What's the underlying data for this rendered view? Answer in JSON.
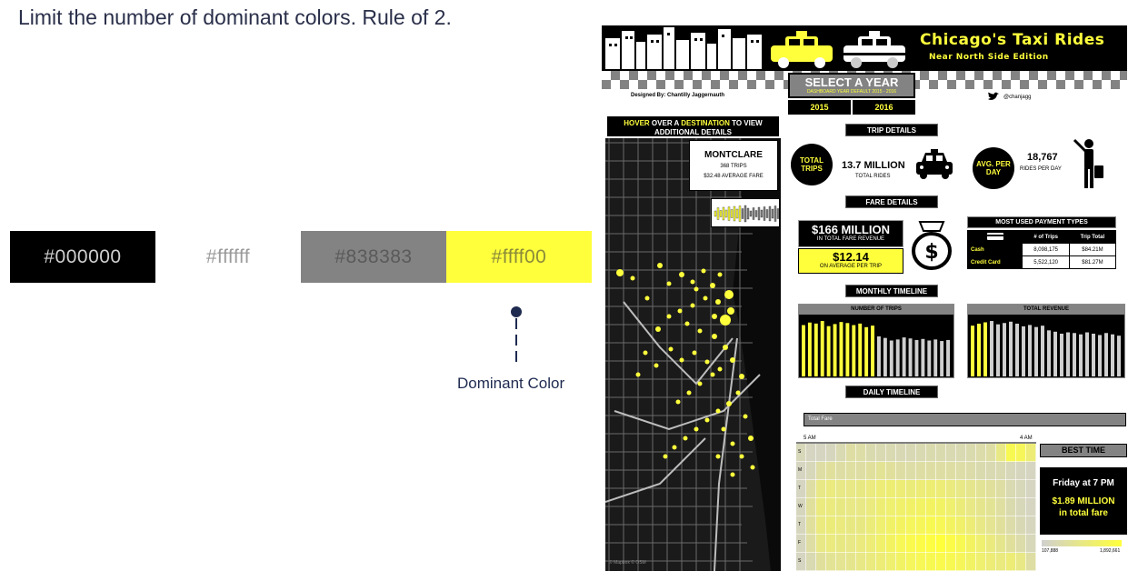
{
  "slide": {
    "title": "Limit the number of dominant colors. Rule of 2.",
    "dominant_label": "Dominant Color"
  },
  "swatches": [
    {
      "label": "#000000",
      "color": "#000000"
    },
    {
      "label": "#ffffff",
      "color": "#ffffff"
    },
    {
      "label": "#838383",
      "color": "#838383"
    },
    {
      "label": "#ffff00",
      "color": "#ffff00"
    }
  ],
  "dashboard": {
    "title": "Chicago's Taxi Rides",
    "subtitle": "Near North Side Edition",
    "designer": "Designed By: Chantilly Jaggernauth",
    "handle": "@chanjagg",
    "year_select": {
      "title": "SELECT A YEAR",
      "subtitle": "DASHBOARD YEAR DEFAULT 2015 - 2016",
      "options": [
        "2015",
        "2016"
      ]
    },
    "map": {
      "header_pre": "HOVER",
      "header_mid1": " OVER A ",
      "header_dest": "DESTINATION",
      "header_post": " TO VIEW ADDITIONAL DETAILS",
      "tooltip_title": "MONTCLARE",
      "tooltip_trips": "368 TRIPS",
      "tooltip_fare": "$32.48 AVERAGE FARE",
      "credit": "© Mapbox © OSM"
    },
    "trip": {
      "header": "TRIP DETAILS",
      "total_circle": "TOTAL TRIPS",
      "total_value": "13.7 MILLION",
      "total_label": "TOTAL RIDES",
      "avg_circle": "AVG. PER DAY",
      "avg_value": "18,767",
      "avg_label": "RIDES PER DAY"
    },
    "fare": {
      "header": "FARE DETAILS",
      "total_value": "$166 MILLION",
      "total_label": "IN TOTAL FARE REVENUE",
      "avg_value": "$12.14",
      "avg_label": "ON AVERAGE PER TRIP"
    },
    "payment": {
      "header": "MOST USED PAYMENT TYPES",
      "col_trips": "# of Trips",
      "col_total": "Trip Total",
      "rows": [
        {
          "type": "Cash",
          "trips": "8,098,175",
          "total": "$84.21M"
        },
        {
          "type": "Credit Card",
          "trips": "5,522,120",
          "total": "$81.27M"
        }
      ]
    },
    "monthly": {
      "header": "MONTHLY TIMELINE",
      "trips_title": "NUMBER OF TRIPS",
      "revenue_title": "TOTAL REVENUE"
    },
    "daily": {
      "header": "DAILY TIMELINE",
      "filter_label": "Total Fare",
      "start_label": "5 AM",
      "end_label": "4 AM",
      "days": [
        "S",
        "M",
        "T",
        "W",
        "T",
        "F",
        "S"
      ]
    },
    "best": {
      "header": "BEST TIME",
      "when": "Friday at 7 PM",
      "amount": "$1.89 MILLION",
      "amount_label": "in total fare",
      "legend_min": "107,888",
      "legend_max": "1,892,661"
    }
  },
  "colors": {
    "black": "#000000",
    "grey": "#838383",
    "yellow": "#ffff3c",
    "light_grey": "#d0d0d0"
  },
  "chart_data": [
    {
      "type": "bar",
      "values": [
        10.0,
        10.5,
        10.3,
        10.8,
        9.8,
        10.2,
        10.6,
        10.4,
        10.0,
        10.3,
        9.6,
        9.9,
        7.8,
        7.5,
        7.0,
        7.2,
        7.6,
        7.4,
        7.1,
        7.3,
        7.0,
        7.2,
        6.9,
        7.1
      ],
      "highlighted_count": 12
    },
    {
      "type": "bar",
      "values": [
        7.6,
        7.9,
        8.1,
        8.3,
        7.8,
        8.0,
        8.2,
        7.9,
        7.5,
        7.7,
        7.4,
        7.6,
        6.9,
        6.7,
        6.4,
        6.6,
        6.5,
        6.3,
        6.6,
        6.4,
        6.2,
        6.5,
        6.3,
        6.1
      ],
      "highlighted_count": 3
    },
    {
      "type": "heatmap",
      "rows": 7,
      "cols": 24,
      "values": [
        [
          0.15,
          0.1,
          0.1,
          0.12,
          0.2,
          0.3,
          0.28,
          0.22,
          0.2,
          0.2,
          0.18,
          0.18,
          0.2,
          0.22,
          0.22,
          0.2,
          0.2,
          0.22,
          0.25,
          0.3,
          0.5,
          0.85,
          0.8,
          0.6
        ],
        [
          0.1,
          0.15,
          0.3,
          0.35,
          0.3,
          0.32,
          0.3,
          0.35,
          0.4,
          0.35,
          0.3,
          0.28,
          0.3,
          0.3,
          0.3,
          0.3,
          0.28,
          0.25,
          0.22,
          0.2,
          0.2,
          0.15,
          0.12,
          0.1
        ],
        [
          0.1,
          0.3,
          0.5,
          0.55,
          0.5,
          0.5,
          0.52,
          0.55,
          0.6,
          0.62,
          0.6,
          0.58,
          0.6,
          0.62,
          0.6,
          0.55,
          0.5,
          0.45,
          0.4,
          0.35,
          0.3,
          0.2,
          0.15,
          0.1
        ],
        [
          0.12,
          0.35,
          0.55,
          0.55,
          0.52,
          0.5,
          0.5,
          0.55,
          0.62,
          0.65,
          0.68,
          0.7,
          0.72,
          0.75,
          0.72,
          0.65,
          0.58,
          0.5,
          0.45,
          0.4,
          0.32,
          0.22,
          0.15,
          0.1
        ],
        [
          0.12,
          0.35,
          0.55,
          0.58,
          0.55,
          0.52,
          0.52,
          0.58,
          0.65,
          0.7,
          0.75,
          0.78,
          0.8,
          0.85,
          0.82,
          0.75,
          0.68,
          0.6,
          0.5,
          0.42,
          0.35,
          0.25,
          0.18,
          0.12
        ],
        [
          0.12,
          0.3,
          0.5,
          0.55,
          0.52,
          0.5,
          0.55,
          0.6,
          0.68,
          0.75,
          0.82,
          0.88,
          0.92,
          0.95,
          1.0,
          0.92,
          0.85,
          0.75,
          0.65,
          0.55,
          0.45,
          0.35,
          0.25,
          0.15
        ],
        [
          0.1,
          0.2,
          0.35,
          0.4,
          0.42,
          0.45,
          0.5,
          0.55,
          0.6,
          0.65,
          0.72,
          0.78,
          0.82,
          0.85,
          0.88,
          0.85,
          0.8,
          0.72,
          0.65,
          0.6,
          0.55,
          0.6,
          0.5,
          0.3
        ]
      ]
    }
  ]
}
